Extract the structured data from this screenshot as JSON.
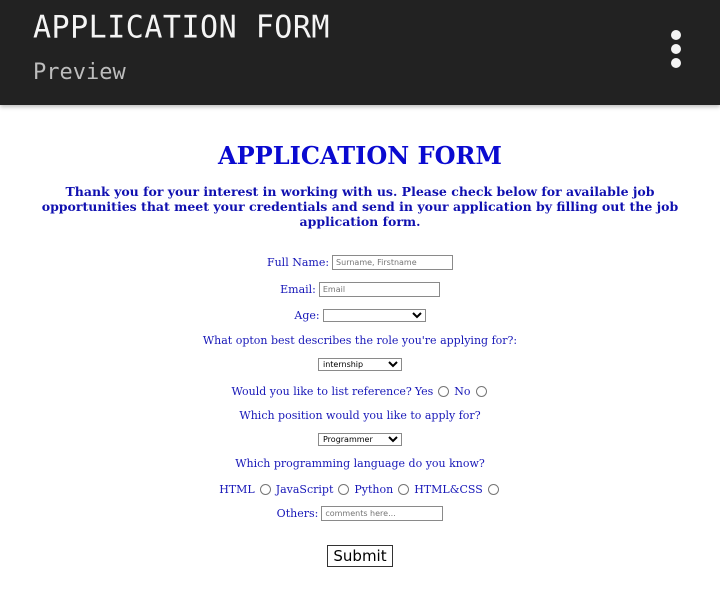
{
  "appbar": {
    "title": "APPLICATION FORM",
    "subtitle": "Preview",
    "menu_icon": "vertical-dots-icon"
  },
  "form": {
    "heading": "APPLICATION FORM",
    "intro": "Thank you for your interest in working with us. Please check below for available job opportunities that meet your credentials and send in your application by filling out the job application form.",
    "full_name_label": "Full Name:",
    "full_name_placeholder": "Surname, Firstname",
    "email_label": "Email:",
    "email_placeholder": "Email",
    "age_label": "Age:",
    "age_value": "",
    "role_question": "What opton best describes the role you're applying for?:",
    "role_value": "internship",
    "reference_question": "Would you like to list reference?",
    "reference_yes": "Yes",
    "reference_no": "No",
    "position_question": "Which position would you like to apply for?",
    "position_value": "Programmer",
    "language_question": "Which programming language do you know?",
    "languages": [
      "HTML",
      "JavaScript",
      "Python",
      "HTML&CSS"
    ],
    "others_label": "Others:",
    "others_placeholder": "comments here...",
    "submit_label": "Submit"
  },
  "colors": {
    "appbar_bg": "#222222",
    "heading": "#0a0ad0",
    "text": "#1818b8"
  }
}
